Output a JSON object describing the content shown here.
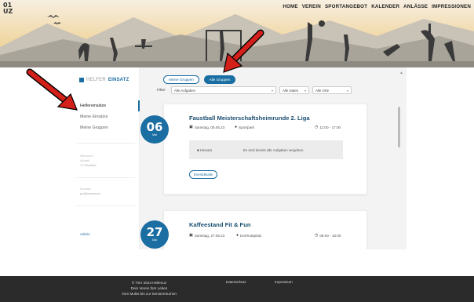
{
  "header": {
    "club_logo_lines": [
      "01",
      "UZ"
    ],
    "nav": [
      "HOME",
      "VEREIN",
      "SPORTANGEBOT",
      "KALENDER",
      "ANLÄSSE",
      "IMPRESSIONEN"
    ]
  },
  "sidebar": {
    "brand_prefix": "HELFER",
    "brand_suffix": "EINSATZ",
    "items": [
      {
        "label": "Helfereinsätze",
        "active": true
      },
      {
        "label": "Meine Einsätze",
        "active": false
      },
      {
        "label": "Meine Gruppen",
        "active": false
      }
    ],
    "stats_label": "Übersicht",
    "stats_sub": "Aktuell",
    "stats_value": "17 Einsätze",
    "user_label": "Kontakt",
    "user_value": "gu@lauemnus",
    "admin_link": "Admin"
  },
  "filters": {
    "my_groups_label": "Meine Gruppen",
    "all_groups_label": "Alle Gruppen",
    "filter_label": "Filter",
    "tasks_select": "Alle Aufgaben",
    "dates_select": "Alle Daten",
    "places_select": "Alle Orte"
  },
  "events": [
    {
      "day": "06",
      "month": "Mai",
      "title": "Faustball Meisterschaftsheimrunde 2. Liga",
      "date": "Samstag, 06.05.23",
      "place": "Sportpark",
      "time": "11:00 - 17:00",
      "hint_label": "Hinweis",
      "hint_text": "Es sind bereits alle Aufgaben vergeben.",
      "details_button": "Eventdetails"
    },
    {
      "day": "27",
      "month": "Mai",
      "title": "Kaffeestand Fit & Fun",
      "date": "Samstag, 27.05.23",
      "place": "Dorfmattplatz",
      "time": "08:00 - 15:00"
    }
  ],
  "footer": {
    "line1": "© TSV 2023 Hellenuz",
    "line2": "Dein Verein fürs Leben",
    "line3": "Vom Mukis bis zur Seniorenturnen",
    "link1": "Datenschutz",
    "link2": "Impressum"
  },
  "colors": {
    "accent": "#1a6ea2",
    "arrow": "#d4201a",
    "footer_bg": "#2b2b2b"
  }
}
